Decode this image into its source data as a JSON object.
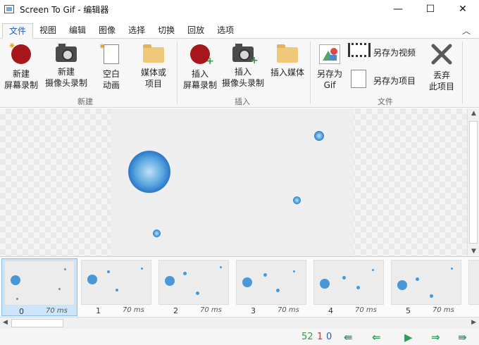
{
  "window": {
    "title": "Screen To Gif - 编辑器",
    "min": "—",
    "max": "☐",
    "close": "✕"
  },
  "tabs": [
    "文件",
    "视图",
    "编辑",
    "图像",
    "选择",
    "切换",
    "回放",
    "选项"
  ],
  "collapse_glyph": "︿",
  "ribbon": {
    "new_group": "新建",
    "insert_group": "插入",
    "file_group": "文件",
    "new_screen_rec": [
      "新建",
      "屏幕录制"
    ],
    "new_webcam_rec": [
      "新建",
      "摄像头录制"
    ],
    "blank_anim": [
      "空白",
      "动画"
    ],
    "media_project": [
      "媒体或",
      "项目"
    ],
    "insert_screen_rec": [
      "插入",
      "屏幕录制"
    ],
    "insert_webcam_rec": [
      "插入",
      "摄像头录制"
    ],
    "insert_media": "插入媒体",
    "save_as_gif": [
      "另存为",
      "Gif"
    ],
    "save_as_video": "另存为视频",
    "save_as_project": "另存为项目",
    "discard": [
      "丢弃",
      "此项目"
    ]
  },
  "frames": [
    {
      "index": "0",
      "delay": "70 ms"
    },
    {
      "index": "1",
      "delay": "70 ms"
    },
    {
      "index": "2",
      "delay": "70 ms"
    },
    {
      "index": "3",
      "delay": "70 ms"
    },
    {
      "index": "4",
      "delay": "70 ms"
    },
    {
      "index": "5",
      "delay": "70 ms"
    }
  ],
  "status": {
    "total": "52",
    "selected": "1",
    "current": "0"
  },
  "colors": {
    "accent": "#1d5fbf",
    "record": "#a6161a",
    "nav_green": "#2f9d5a"
  }
}
